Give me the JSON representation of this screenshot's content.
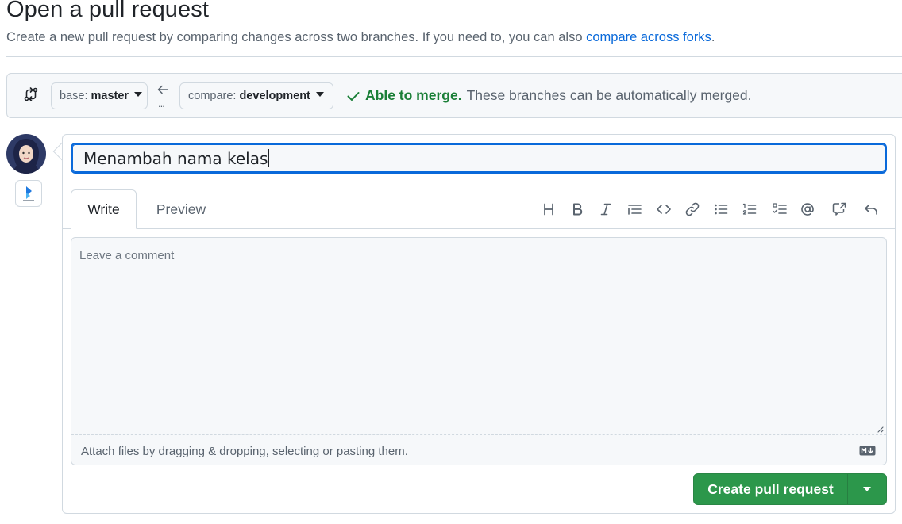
{
  "page": {
    "title": "Open a pull request",
    "subtitle": "Create a new pull request by comparing changes across two branches. If you need to, you can also ",
    "subtitle_link": "compare across forks",
    "subtitle_end": "."
  },
  "range": {
    "base_prefix": "base:",
    "base_branch": "master",
    "compare_prefix": "compare:",
    "compare_branch": "development",
    "swap_dots": "...",
    "merge_strong": "Able to merge.",
    "merge_text": "These branches can be automatically merged."
  },
  "form": {
    "title_value": "Menambah nama kelas",
    "tabs": {
      "write": "Write",
      "preview": "Preview"
    },
    "toolbar_icons": [
      "heading-icon",
      "bold-icon",
      "italic-icon",
      "quote-icon",
      "code-icon",
      "link-icon",
      "unordered-list-icon",
      "ordered-list-icon",
      "task-list-icon",
      "mention-icon",
      "cross-reference-icon",
      "saved-replies-icon"
    ],
    "comment_placeholder": "Leave a comment",
    "attach_text": "Attach files by dragging & dropping, selecting or pasting them.",
    "submit_label": "Create pull request"
  },
  "colors": {
    "accent_blue": "#0969da",
    "merge_green": "#1a7f37",
    "button_green": "#2c974b"
  }
}
